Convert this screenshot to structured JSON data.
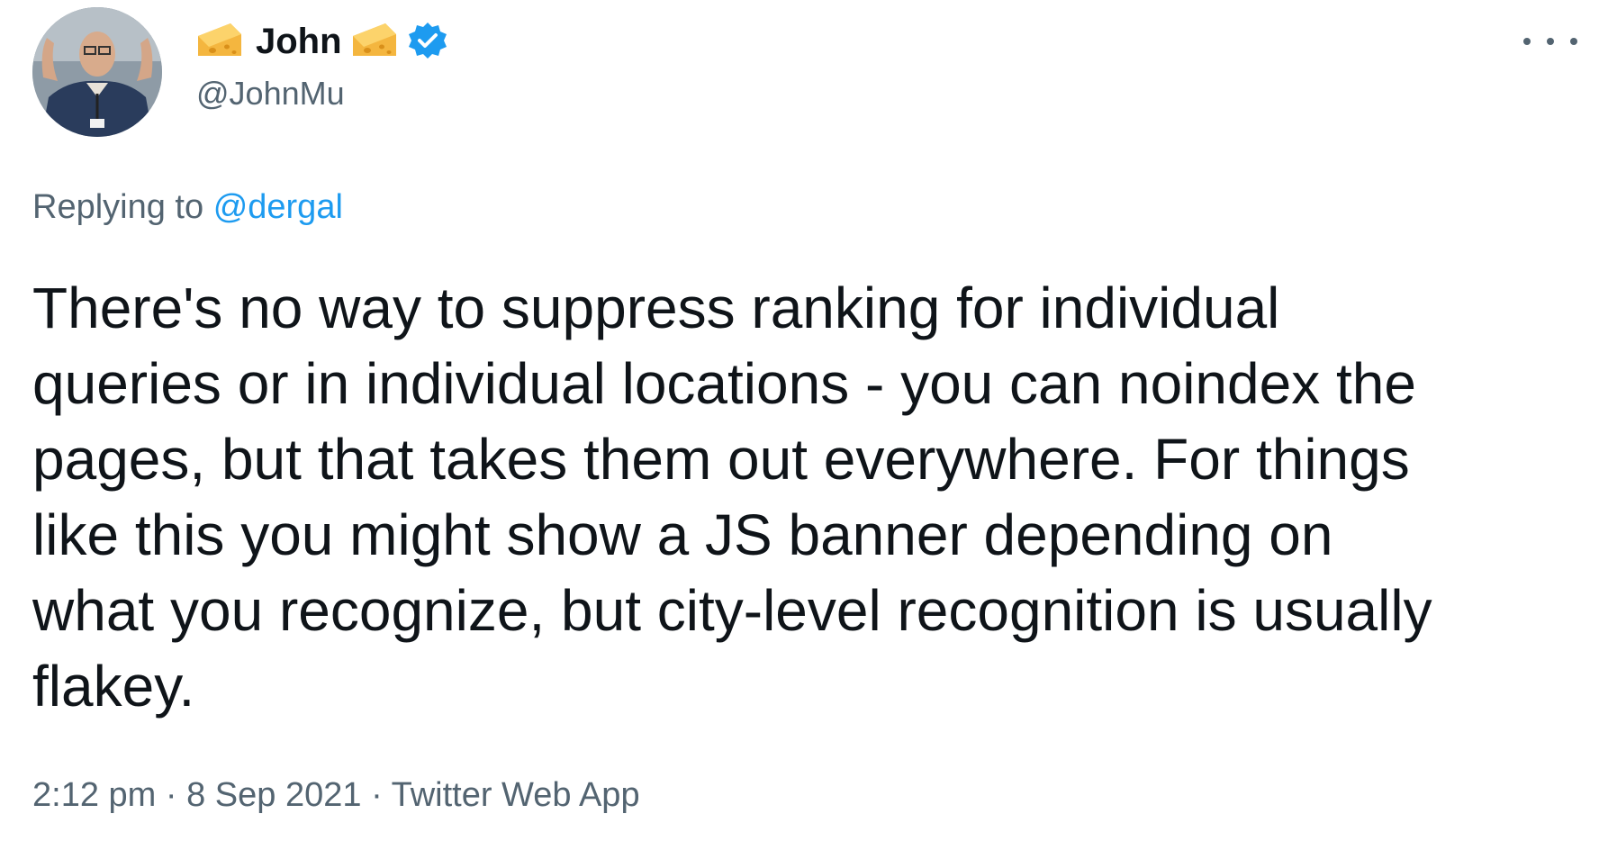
{
  "author": {
    "display_name": "John",
    "handle": "@JohnMu",
    "verified": true,
    "name_emoji": "cheese-emoji"
  },
  "reply": {
    "prefix": "Replying to",
    "target": "@dergal"
  },
  "tweet": {
    "text": "There's no way to suppress ranking for individual\nqueries or in individual locations - you can noindex the\npages, but that takes them out everywhere. For things\nlike this you might show a JS banner depending on\nwhat you recognize, but city-level recognition is usually\nflakey."
  },
  "meta": {
    "time": "2:12 pm",
    "date": "8 Sep 2021",
    "source": "Twitter Web App",
    "separator": "·"
  },
  "icons": {
    "verified": "verified-badge-icon",
    "more": "more-options-icon"
  },
  "colors": {
    "link": "#1d9bf0",
    "secondary_text": "#536471",
    "primary_text": "#0f1419",
    "verified": "#1d9bf0"
  }
}
